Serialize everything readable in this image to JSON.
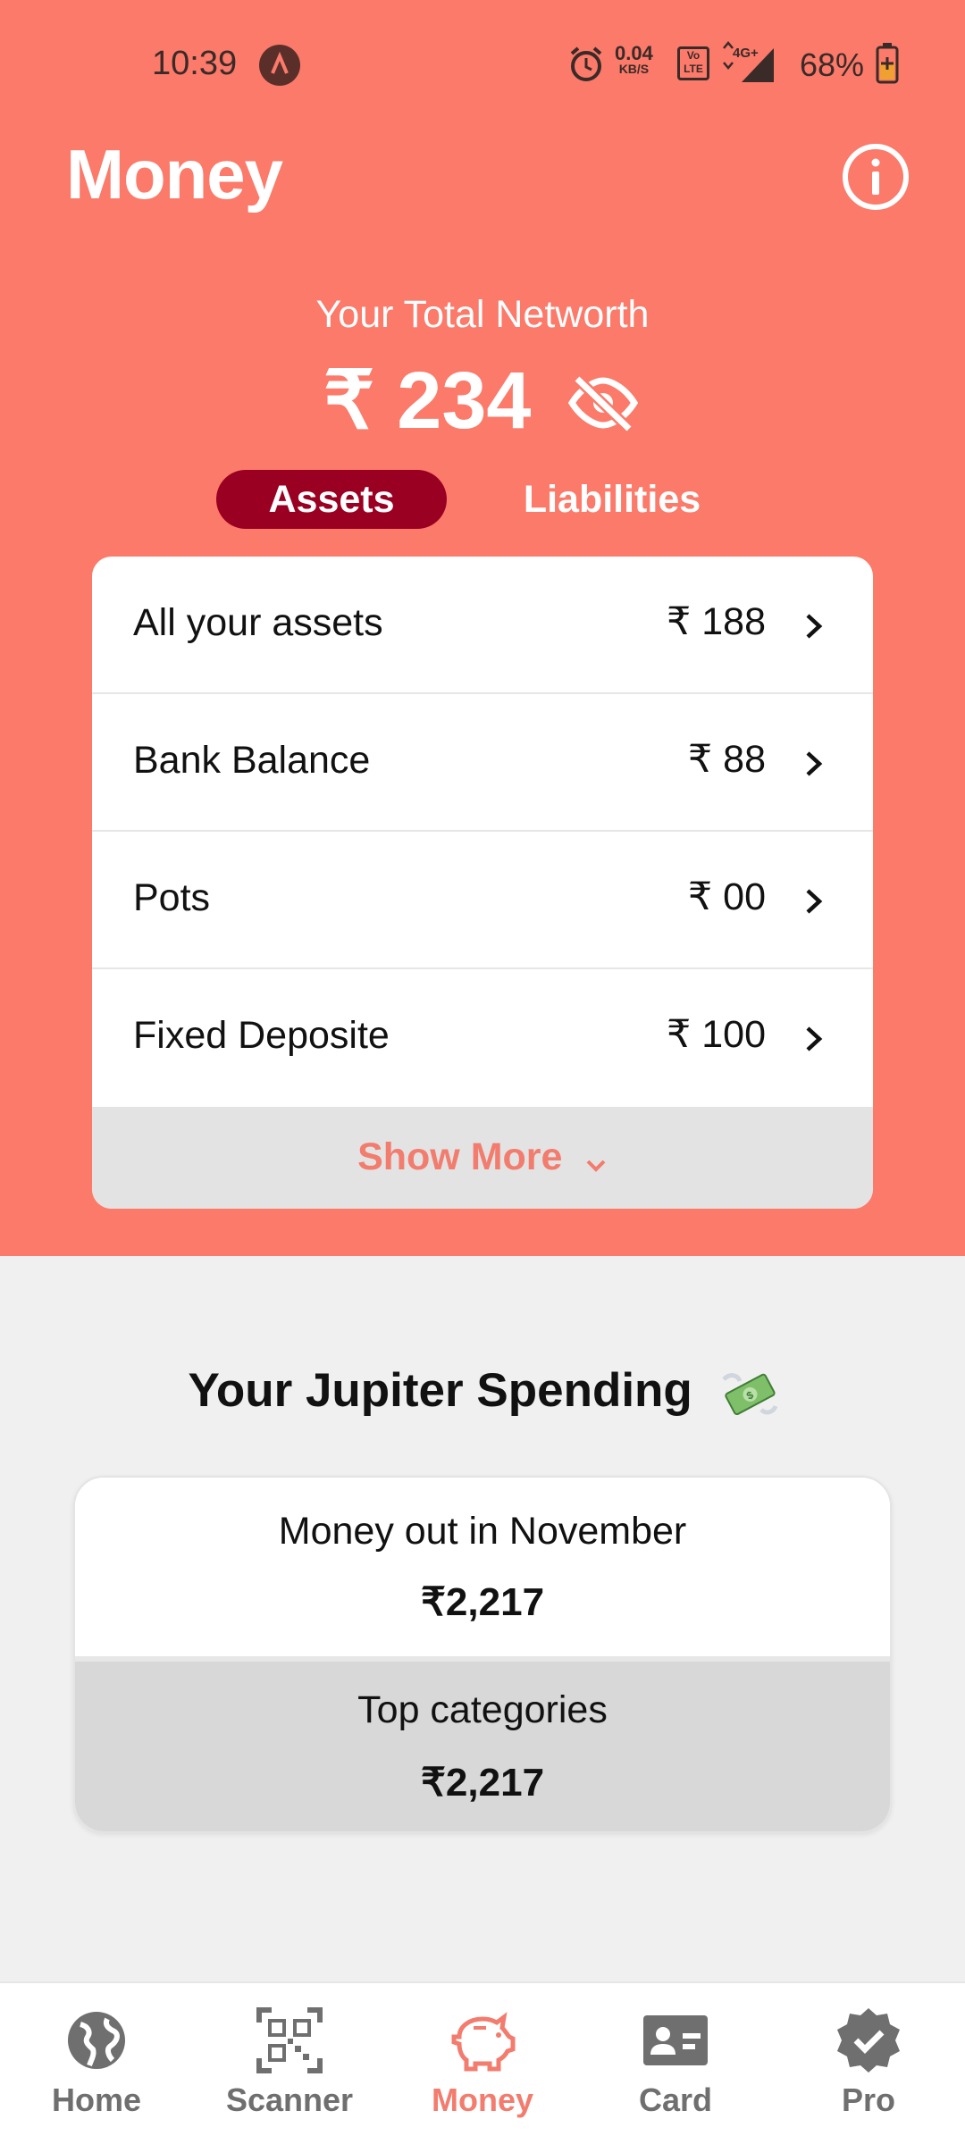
{
  "status_bar": {
    "time": "10:39",
    "net_speed": "0.04",
    "net_unit": "KB/S",
    "volte": "Vo LTE",
    "network": "4G+",
    "battery": "68%"
  },
  "header": {
    "title": "Money",
    "info_icon": "info-circle-icon"
  },
  "networth": {
    "label": "Your Total Networth",
    "value": "₹ 234",
    "visibility_icon": "eye-off-icon"
  },
  "tabs": [
    {
      "label": "Assets",
      "active": true
    },
    {
      "label": "Liabilities",
      "active": false
    }
  ],
  "assets": [
    {
      "label": "All your assets",
      "value": "₹ 188"
    },
    {
      "label": "Bank Balance",
      "value": "₹ 88"
    },
    {
      "label": "Pots",
      "value": "₹ 00"
    },
    {
      "label": "Fixed Deposite",
      "value": "₹ 100"
    }
  ],
  "show_more": "Show More",
  "spending": {
    "title": "Your Jupiter Spending",
    "emoji_icon": "money-with-wings-icon",
    "money_out_label": "Money out in November",
    "money_out_value": "₹2,217",
    "top_categories_label": "Top categories",
    "top_categories_value": "₹2,217"
  },
  "bottom_nav": [
    {
      "label": "Home",
      "icon": "globe-icon",
      "active": false
    },
    {
      "label": "Scanner",
      "icon": "qr-code-icon",
      "active": false
    },
    {
      "label": "Money",
      "icon": "piggy-bank-icon",
      "active": true
    },
    {
      "label": "Card",
      "icon": "id-card-icon",
      "active": false
    },
    {
      "label": "Pro",
      "icon": "verified-badge-icon",
      "active": false
    }
  ],
  "colors": {
    "accent": "#fb7a6a",
    "active_tab": "#9a0022",
    "nav_active": "#f27c6e"
  }
}
